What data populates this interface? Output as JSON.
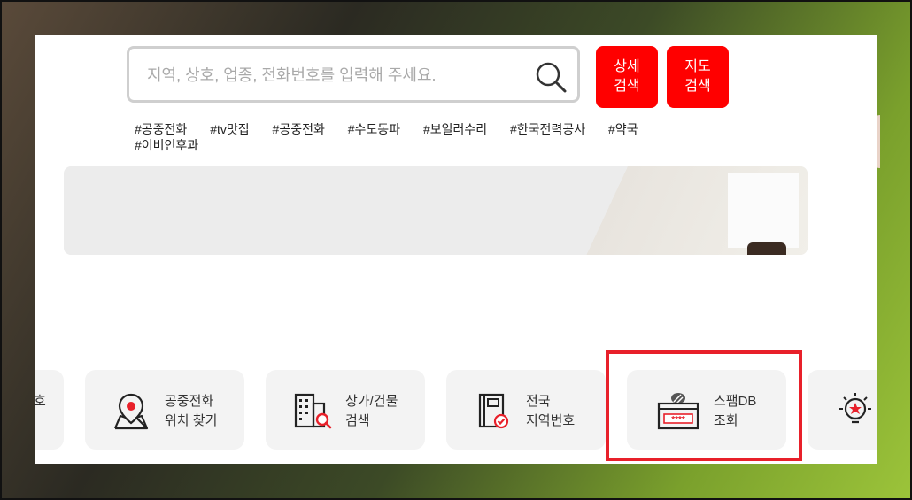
{
  "search": {
    "placeholder": "지역, 상호, 업종, 전화번호를 입력해 주세요.",
    "value": ""
  },
  "buttons": {
    "detail_line1": "상세",
    "detail_line2": "검색",
    "map_line1": "지도",
    "map_line2": "검색"
  },
  "hashtags": [
    "#공중전화",
    "#tv맛집",
    "#공중전화",
    "#수도동파",
    "#보일러수리",
    "#한국전력공사",
    "#약국",
    "#이비인후과"
  ],
  "cards": [
    {
      "line1": "호",
      "line2": ""
    },
    {
      "line1": "공중전화",
      "line2": "위치 찾기",
      "icon": "map-pin-icon"
    },
    {
      "line1": "상가/건물",
      "line2": "검색",
      "icon": "building-search-icon"
    },
    {
      "line1": "전국",
      "line2": "지역번호",
      "icon": "book-check-icon"
    },
    {
      "line1": "스팸DB",
      "line2": "조회",
      "icon": "spam-db-icon",
      "masked": "****"
    },
    {
      "icon": "lightbulb-star-icon"
    }
  ],
  "colors": {
    "accent_red": "#ff0000",
    "highlight_red": "#e8202a",
    "card_bg": "#f3f3f3"
  }
}
